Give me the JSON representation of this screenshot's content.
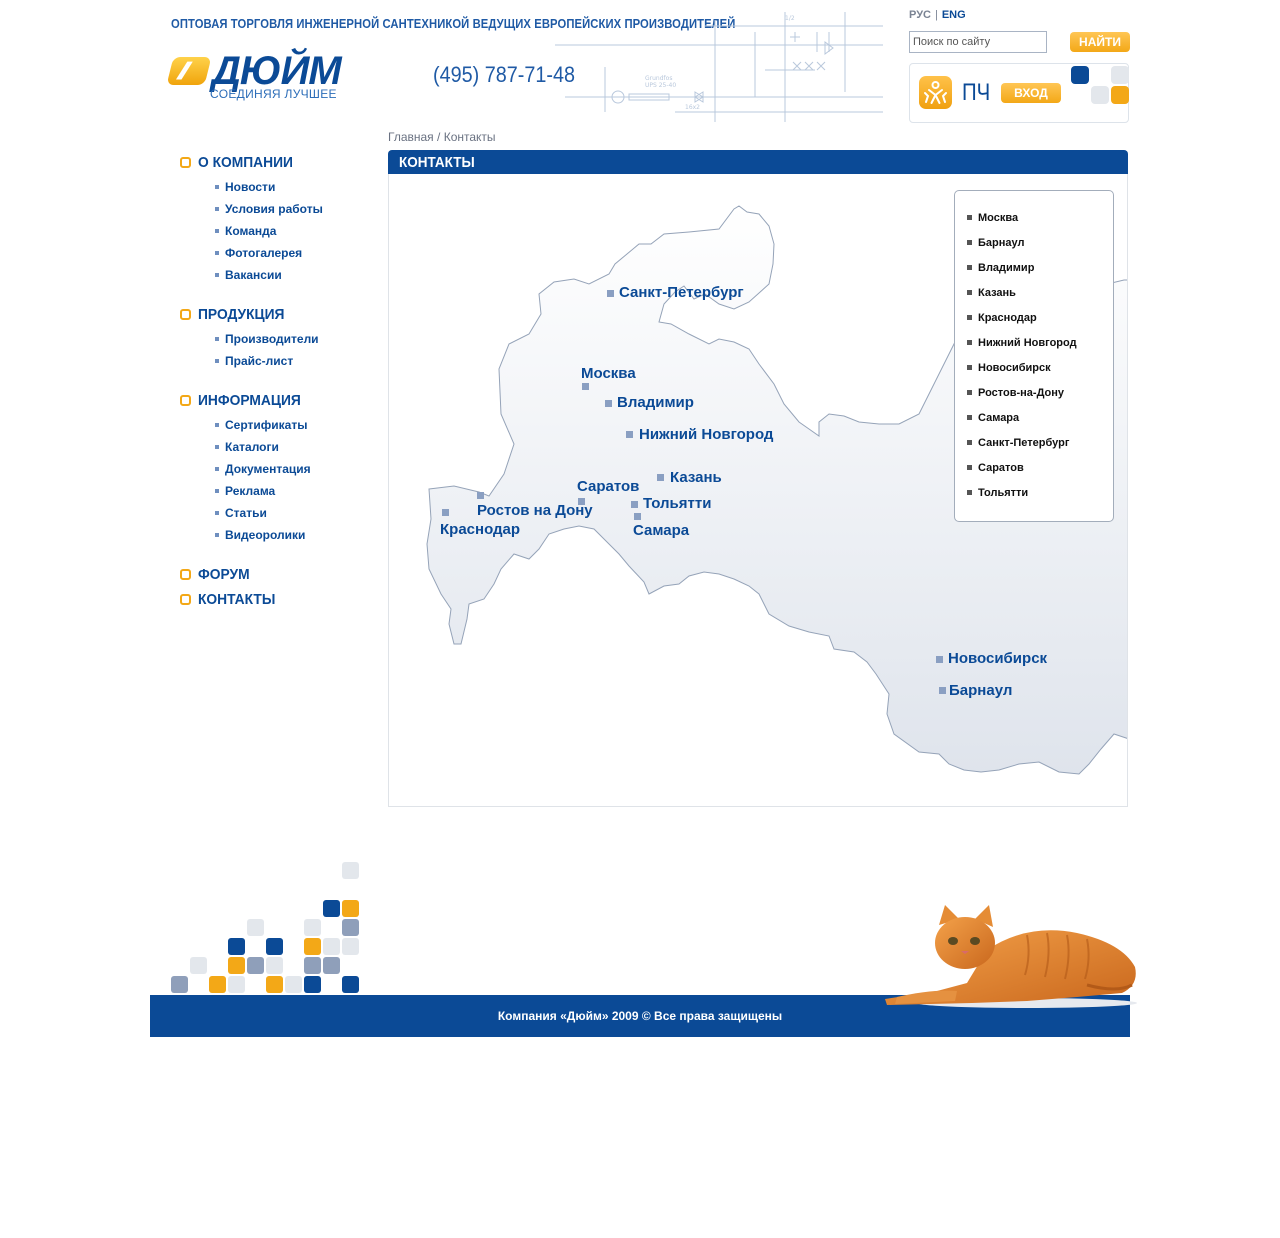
{
  "header": {
    "tagline": "ОПТОВАЯ ТОРГОВЛЯ ИНЖЕНЕРНОЙ САНТЕХНИКОЙ ВЕДУЩИХ ЕВРОПЕЙСКИХ ПРОИЗВОДИТЕЛЕЙ",
    "logo_word": "ДЮЙМ",
    "logo_slogan": "СОЕДИНЯЯ ЛУЧШЕЕ",
    "phone": "(495) 787-71-48"
  },
  "languages": {
    "ru": "РУС",
    "separator": "|",
    "en": "ENG"
  },
  "search": {
    "value": "Поиск по сайту",
    "button_label": "НАЙТИ"
  },
  "login": {
    "label": "ПЧ",
    "button_label": "ВХОД"
  },
  "breadcrumb": {
    "home": "Главная",
    "separator": "/",
    "current": "Контакты"
  },
  "nav": {
    "sections": [
      {
        "label": "О КОМПАНИИ",
        "items": [
          "Новости",
          "Условия работы",
          "Команда",
          "Фотогалерея",
          "Вакансии"
        ]
      },
      {
        "label": "ПРОДУКЦИЯ",
        "items": [
          "Производители",
          "Прайс-лист"
        ]
      },
      {
        "label": "ИНФОРМАЦИЯ",
        "items": [
          "Сертификаты",
          "Каталоги",
          "Документация",
          "Реклама",
          "Статьи",
          "Видеоролики"
        ]
      }
    ],
    "forum": "ФОРУМ",
    "contacts": "КОНТАКТЫ"
  },
  "content": {
    "title": "КОНТАКТЫ",
    "city_list": [
      "Москва",
      "Барнаул",
      "Владимир",
      "Казань",
      "Краснодар",
      "Нижний Новгород",
      "Новосибирск",
      "Ростов-на-Дону",
      "Самара",
      "Санкт-Петербург",
      "Саратов",
      "Тольятти"
    ],
    "map_labels": {
      "spb": "Санкт-Петербург",
      "moscow": "Москва",
      "vladimir": "Владимир",
      "nnovgorod": "Нижний Новгород",
      "kazan": "Казань",
      "saratov": "Саратов",
      "tolyatti": "Тольятти",
      "samara": "Самара",
      "rostov": "Ростов на Дону",
      "krasnodar": "Краснодар",
      "novosibirsk": "Новосибирск",
      "barnaul": "Барнаул"
    }
  },
  "footer": {
    "copyright": "Компания «Дюйм» 2009 © Все права защищены"
  },
  "colors": {
    "brand_blue": "#0b4a96",
    "accent_orange": "#f3a817",
    "tile_grey": "#e3e7ec",
    "tile_slate": "#8f9fba"
  }
}
